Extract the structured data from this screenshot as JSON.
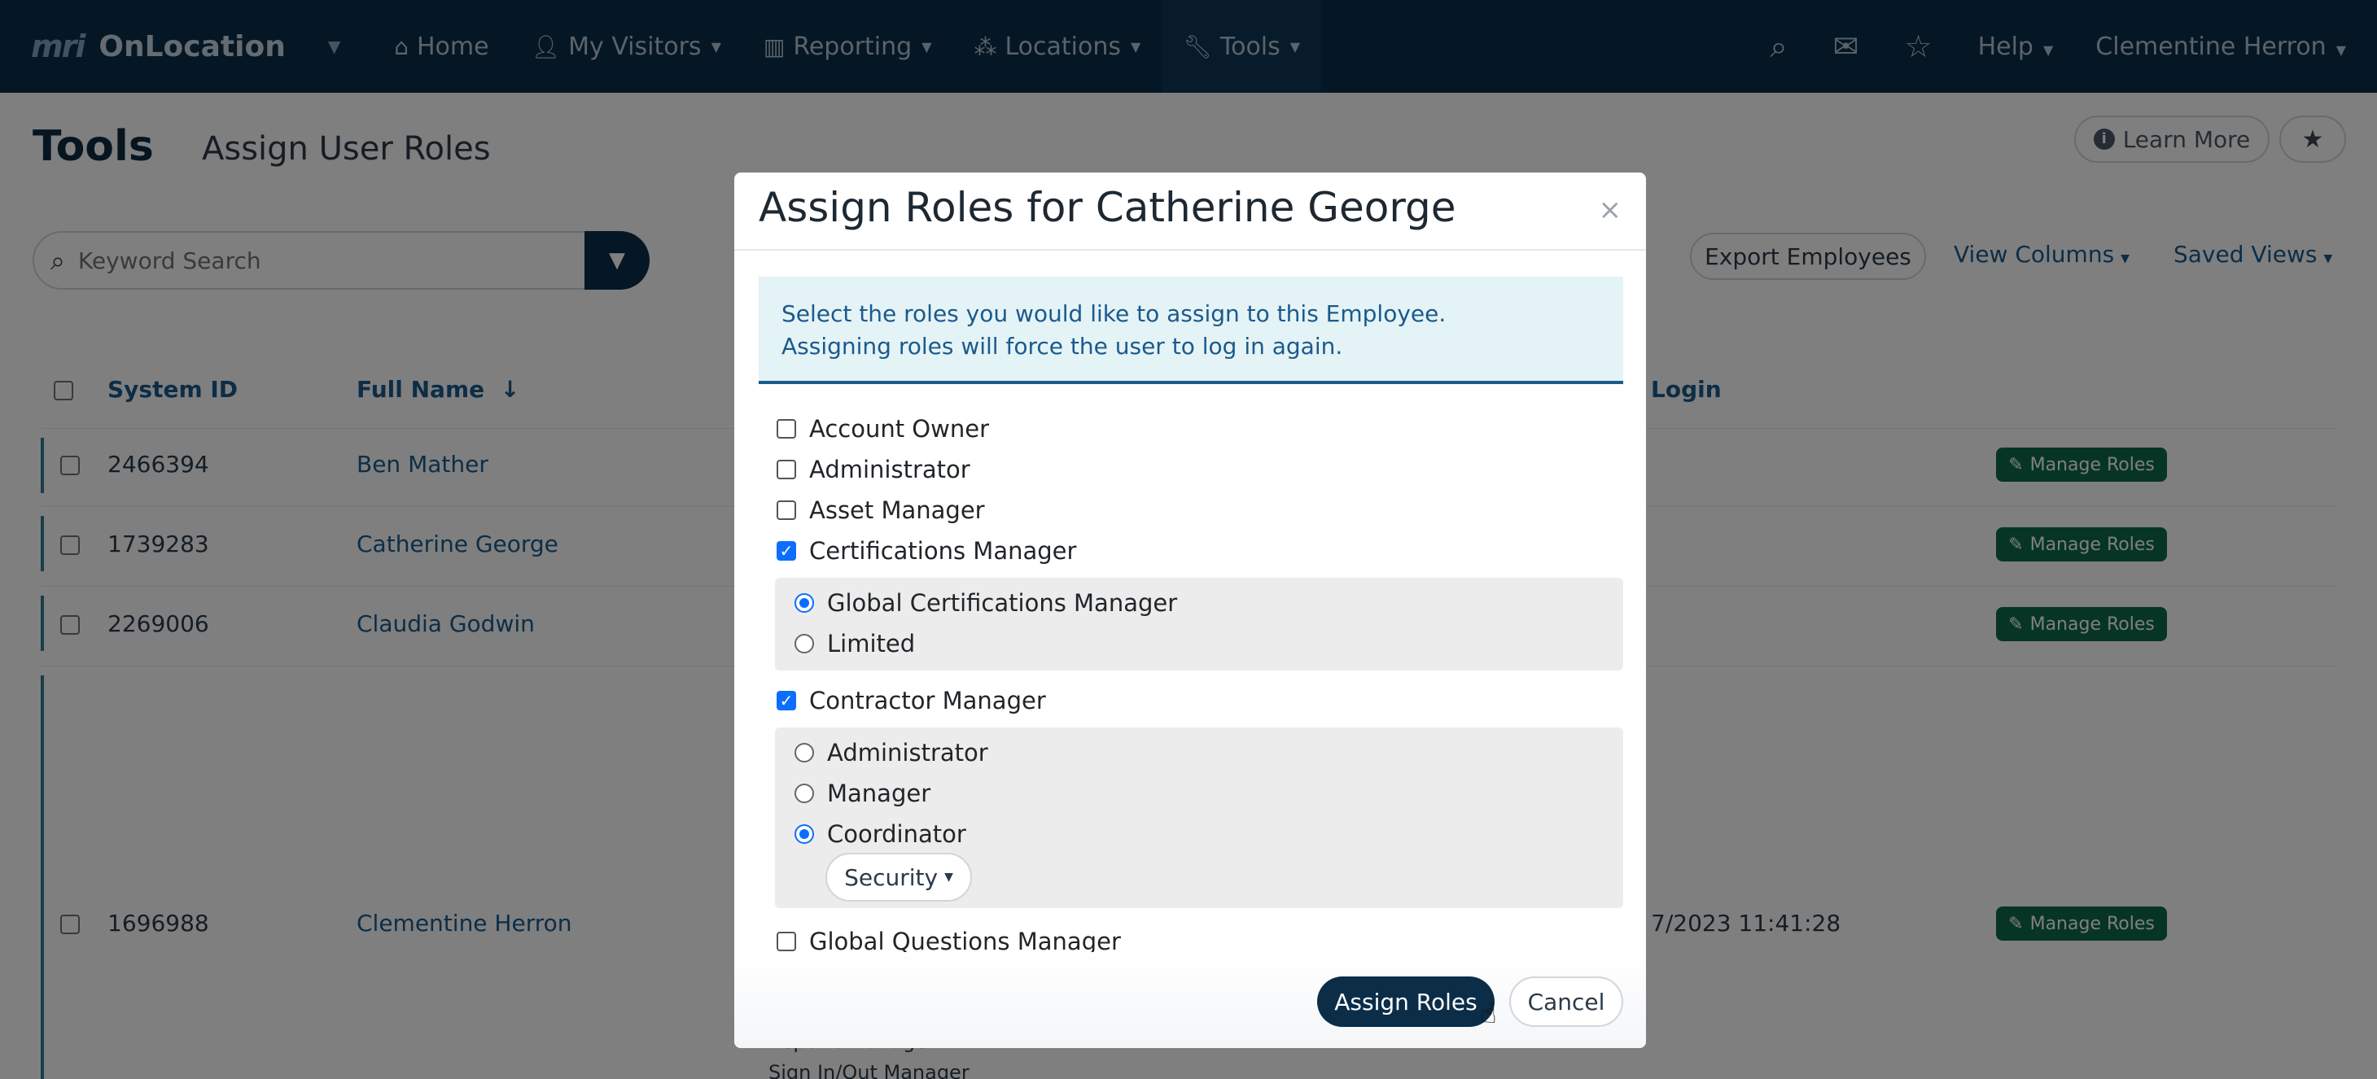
{
  "nav": {
    "brand_mark": "mri",
    "brand_name": "OnLocation",
    "items": [
      {
        "label": "Home",
        "icon": "home-icon"
      },
      {
        "label": "My Visitors",
        "icon": "user-icon"
      },
      {
        "label": "Reporting",
        "icon": "bar-chart-icon"
      },
      {
        "label": "Locations",
        "icon": "locations-icon"
      },
      {
        "label": "Tools",
        "icon": "wrench-icon"
      }
    ],
    "help": "Help",
    "user": "Clementine Herron"
  },
  "page": {
    "title": "Tools",
    "subtitle": "Assign User Roles",
    "learn_more": "Learn More",
    "search_placeholder": "Keyword Search",
    "export": "Export Employees",
    "view_columns": "View Columns",
    "saved_views": "Saved Views"
  },
  "table": {
    "columns": [
      "System ID",
      "Full Name",
      "Login"
    ],
    "sort_indicator": "↓",
    "manage_label": "Manage Roles",
    "rows": [
      {
        "id": "2466394",
        "name": "Ben Mather",
        "last_login": ""
      },
      {
        "id": "1739283",
        "name": "Catherine George",
        "last_login": ""
      },
      {
        "id": "2269006",
        "name": "Claudia Godwin",
        "last_login": ""
      },
      {
        "id": "1696988",
        "name": "Clementine Herron",
        "last_login": "7/2023 11:41:28"
      }
    ],
    "partial_role_texts": [
      "Reports Manager",
      "Sign In/Out Manager"
    ]
  },
  "modal": {
    "title": "Assign Roles for Catherine George",
    "close": "×",
    "info": "Select the roles you would like to assign to this Employee. Assigning roles will force the user to log in again.",
    "roles": [
      {
        "label": "Account Owner",
        "checked": false
      },
      {
        "label": "Administrator",
        "checked": false
      },
      {
        "label": "Asset Manager",
        "checked": false
      },
      {
        "label": "Certifications Manager",
        "checked": true
      },
      {
        "label": "Contractor Manager",
        "checked": true
      },
      {
        "label": "Global Questions Manager",
        "checked": false
      }
    ],
    "cert_options": [
      "Global Certifications Manager",
      "Limited"
    ],
    "cert_selected": "Global Certifications Manager",
    "contractor_options": [
      "Administrator",
      "Manager",
      "Coordinator"
    ],
    "contractor_selected": "Coordinator",
    "security_dropdown": "Security",
    "assign_button": "Assign Roles",
    "cancel_button": "Cancel"
  },
  "colors": {
    "nav_bg": "#0b2d48",
    "link": "#1b5a8c",
    "manage_btn": "#0e6b4a",
    "checkbox_on": "#0d6efd"
  }
}
